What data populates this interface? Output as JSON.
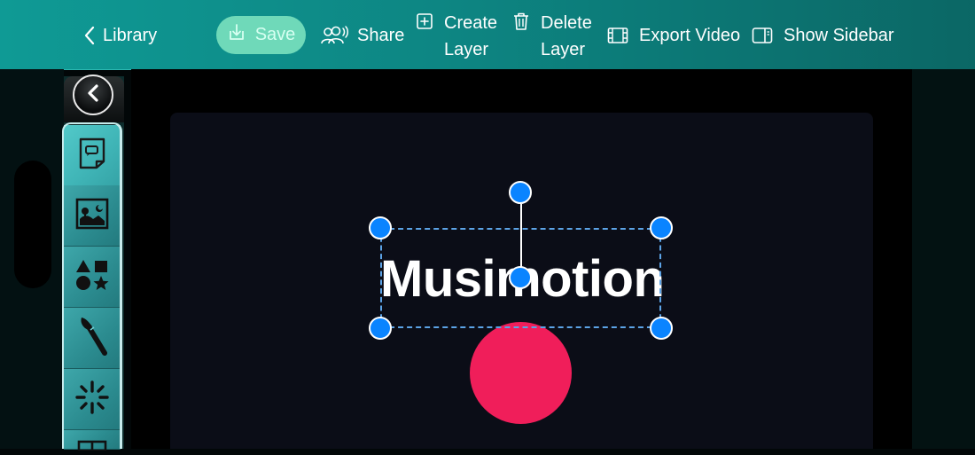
{
  "toolbar": {
    "back_label": "Library",
    "save_label": "Save",
    "share_label": "Share",
    "create_layer_line1": "Create",
    "create_layer_line2": "Layer",
    "delete_layer_line1": "Delete",
    "delete_layer_line2": "Layer",
    "export_label": "Export Video",
    "sidebar_label": "Show Sidebar"
  },
  "tools": [
    {
      "name": "text-tool",
      "icon": "text-note-icon",
      "active": true
    },
    {
      "name": "image-tool",
      "icon": "image-icon",
      "active": false
    },
    {
      "name": "shapes-tool",
      "icon": "shapes-icon",
      "active": false
    },
    {
      "name": "brush-tool",
      "icon": "brush-icon",
      "active": false
    },
    {
      "name": "effects-tool",
      "icon": "sparkle-icon",
      "active": false
    },
    {
      "name": "more-tool",
      "icon": "frame-icon",
      "active": false
    }
  ],
  "canvas": {
    "text_layer": "Musimotion",
    "shape_color": "#f01e5a",
    "handle_color": "#0a84ff"
  },
  "colors": {
    "toolbar_accent": "#0f9a95",
    "save_button": "#6fd9b9"
  }
}
